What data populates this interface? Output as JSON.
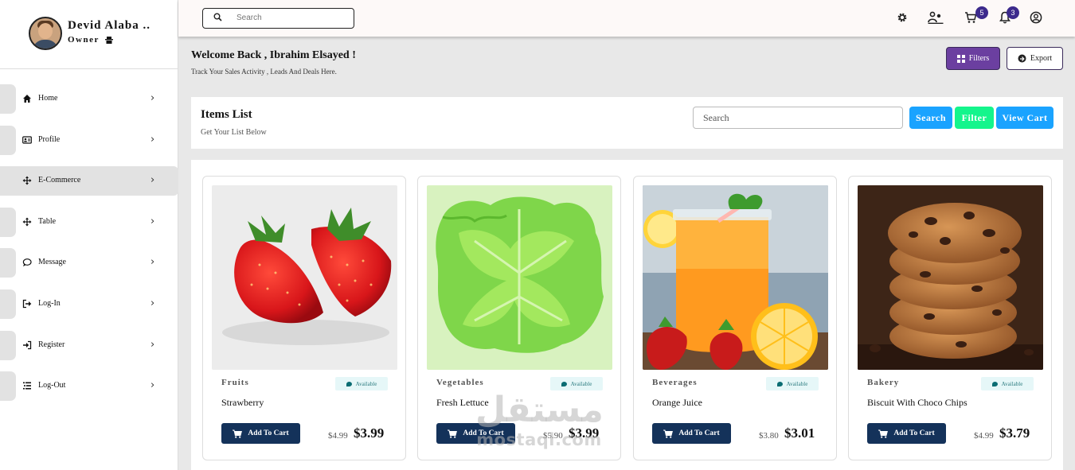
{
  "sidebar": {
    "user_name": "Devid Alaba ..",
    "user_role": "Owner",
    "items": [
      {
        "label": "Home",
        "icon": "home-icon"
      },
      {
        "label": "Profile",
        "icon": "profile-card-icon"
      },
      {
        "label": "E-Commerce",
        "icon": "move-arrows-icon"
      },
      {
        "label": "Table",
        "icon": "move-arrows-icon"
      },
      {
        "label": "Message",
        "icon": "chat-bubble-icon"
      },
      {
        "label": "Log-In",
        "icon": "sign-out-icon"
      },
      {
        "label": "Register",
        "icon": "sign-in-icon"
      },
      {
        "label": "Log-Out",
        "icon": "list-icon"
      }
    ],
    "active_index": 2
  },
  "topbar": {
    "search_placeholder": "Search",
    "cart_count": "5",
    "notifications_count": "3"
  },
  "welcome": {
    "title": "Welcome Back , Ibrahim Elsayed !",
    "subtitle": "Track Your Sales Activity , Leads And Deals Here.",
    "filters_label": "Filters",
    "export_label": "Export"
  },
  "items_list": {
    "title": "Items List",
    "subtitle": "Get Your List Below",
    "search_placeholder": "Search",
    "search_button": "Search",
    "filter_button": "Filter",
    "view_cart_button": "View Cart"
  },
  "products": [
    {
      "category": "Fruits",
      "availability": "Available",
      "name": "Strawberry",
      "old_price": "$4.99",
      "price": "$3.99",
      "add_label": "Add To Cart"
    },
    {
      "category": "Vegetables",
      "availability": "Available",
      "name": "Fresh Lettuce",
      "old_price": "$5.90",
      "price": "$3.99",
      "add_label": "Add To Cart"
    },
    {
      "category": "Beverages",
      "availability": "Available",
      "name": "Orange Juice",
      "old_price": "$3.80",
      "price": "$3.01",
      "add_label": "Add To Cart"
    },
    {
      "category": "Bakery",
      "availability": "Available",
      "name": "Biscuit With Choco Chips",
      "old_price": "$4.99",
      "price": "$3.79",
      "add_label": "Add To Cart"
    }
  ],
  "watermark": {
    "arabic": "مستقل",
    "latin": "mostaql.com"
  },
  "colors": {
    "filters_button": "#6b3fa0",
    "search_button": "#1aa3ff",
    "filter_button": "#14f58c",
    "view_cart_button": "#1aa3ff",
    "add_to_cart": "#14325a",
    "badge": "#3c2a8c"
  }
}
